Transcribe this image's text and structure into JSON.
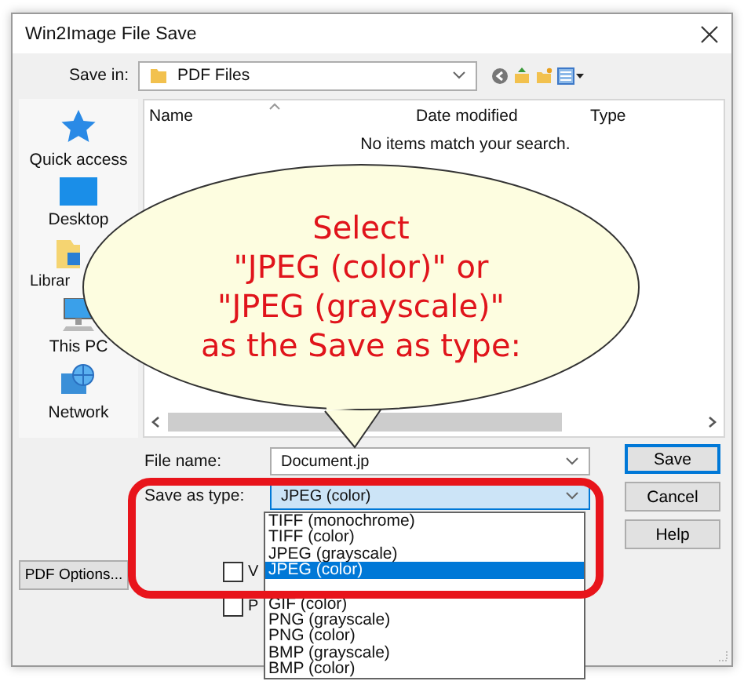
{
  "window": {
    "title": "Win2Image File Save"
  },
  "save_in": {
    "label": "Save in:",
    "value": "PDF Files"
  },
  "places": [
    {
      "label": "Quick access",
      "kind": "quick"
    },
    {
      "label": "Desktop",
      "kind": "desktop"
    },
    {
      "label": "Librar",
      "kind": "libraries"
    },
    {
      "label": "This PC",
      "kind": "pc"
    },
    {
      "label": "Network",
      "kind": "network"
    }
  ],
  "file_list": {
    "columns": [
      "Name",
      "Date modified",
      "Type"
    ],
    "empty_message": "No items match your search."
  },
  "file_name": {
    "label": "File name:",
    "value": "Document.jp"
  },
  "save_as_type": {
    "label": "Save as type:",
    "value": "JPEG (color)",
    "options": [
      {
        "label": "TIFF (monochrome)",
        "selected": false
      },
      {
        "label": "TIFF (color)",
        "selected": false
      },
      {
        "label": "JPEG (grayscale)",
        "selected": false
      },
      {
        "label": "JPEG (color)",
        "selected": true
      },
      {
        "label": "GIF (color)",
        "selected": false
      },
      {
        "label": "PNG (grayscale)",
        "selected": false
      },
      {
        "label": "PNG (color)",
        "selected": false
      },
      {
        "label": "BMP (grayscale)",
        "selected": false
      },
      {
        "label": "BMP (color)",
        "selected": false
      }
    ]
  },
  "buttons": [
    "Save",
    "Cancel",
    "Help"
  ],
  "pdf_options_button": "PDF Options...",
  "checkboxes": [
    {
      "label": "V",
      "checked": false
    },
    {
      "label": "P",
      "checked": false
    }
  ],
  "callout": {
    "lines": [
      "Select",
      "\"JPEG (color)\" or",
      "\"JPEG (grayscale)\"",
      "as the Save as type:"
    ]
  }
}
